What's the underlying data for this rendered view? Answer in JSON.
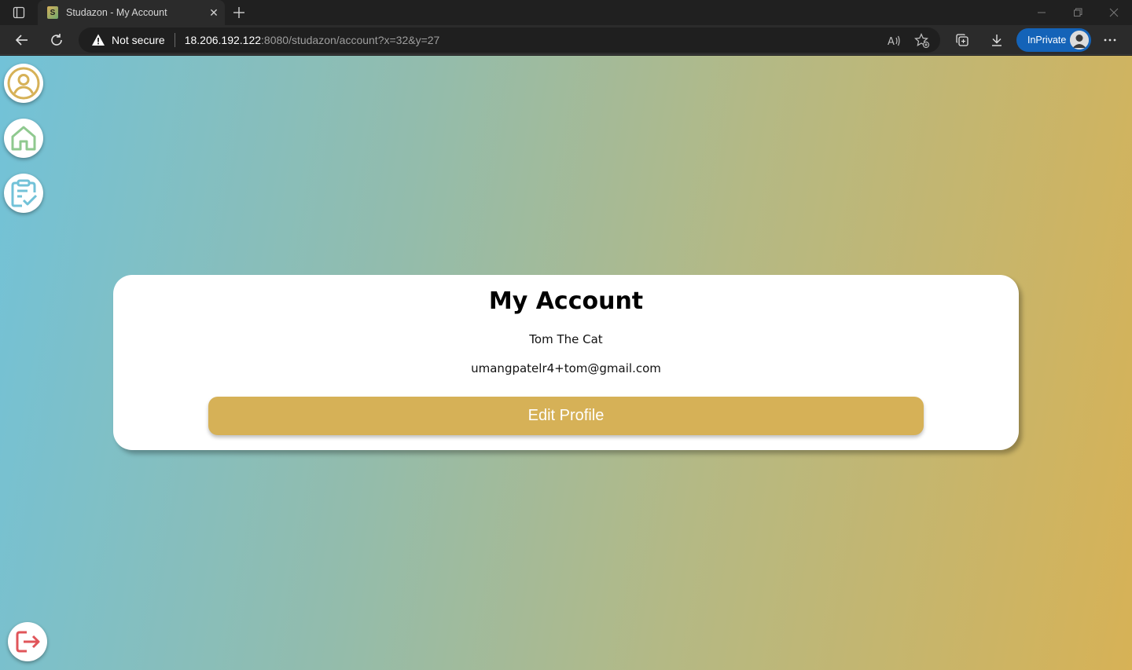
{
  "browser": {
    "tab_title": "Studazon - My Account",
    "address": {
      "security_label": "Not secure",
      "host": "18.206.192.122",
      "rest": ":8080/studazon/account?x=32&y=27"
    },
    "inprivate_label": "InPrivate"
  },
  "sidebar": {
    "items": [
      {
        "name": "account",
        "icon": "user-circle-icon",
        "color": "#d6b157"
      },
      {
        "name": "home",
        "icon": "home-icon",
        "color": "#8fc98f"
      },
      {
        "name": "tasks",
        "icon": "clipboard-check-icon",
        "color": "#72c2d8"
      }
    ],
    "logout": {
      "icon": "logout-icon",
      "color": "#e0555a"
    }
  },
  "account": {
    "title": "My Account",
    "name": "Tom The Cat",
    "email": "umangpatelr4+tom@gmail.com",
    "edit_button": "Edit Profile"
  },
  "colors": {
    "gradient_start": "#72c2d8",
    "gradient_end": "#d7b256",
    "button": "#d6b157"
  }
}
